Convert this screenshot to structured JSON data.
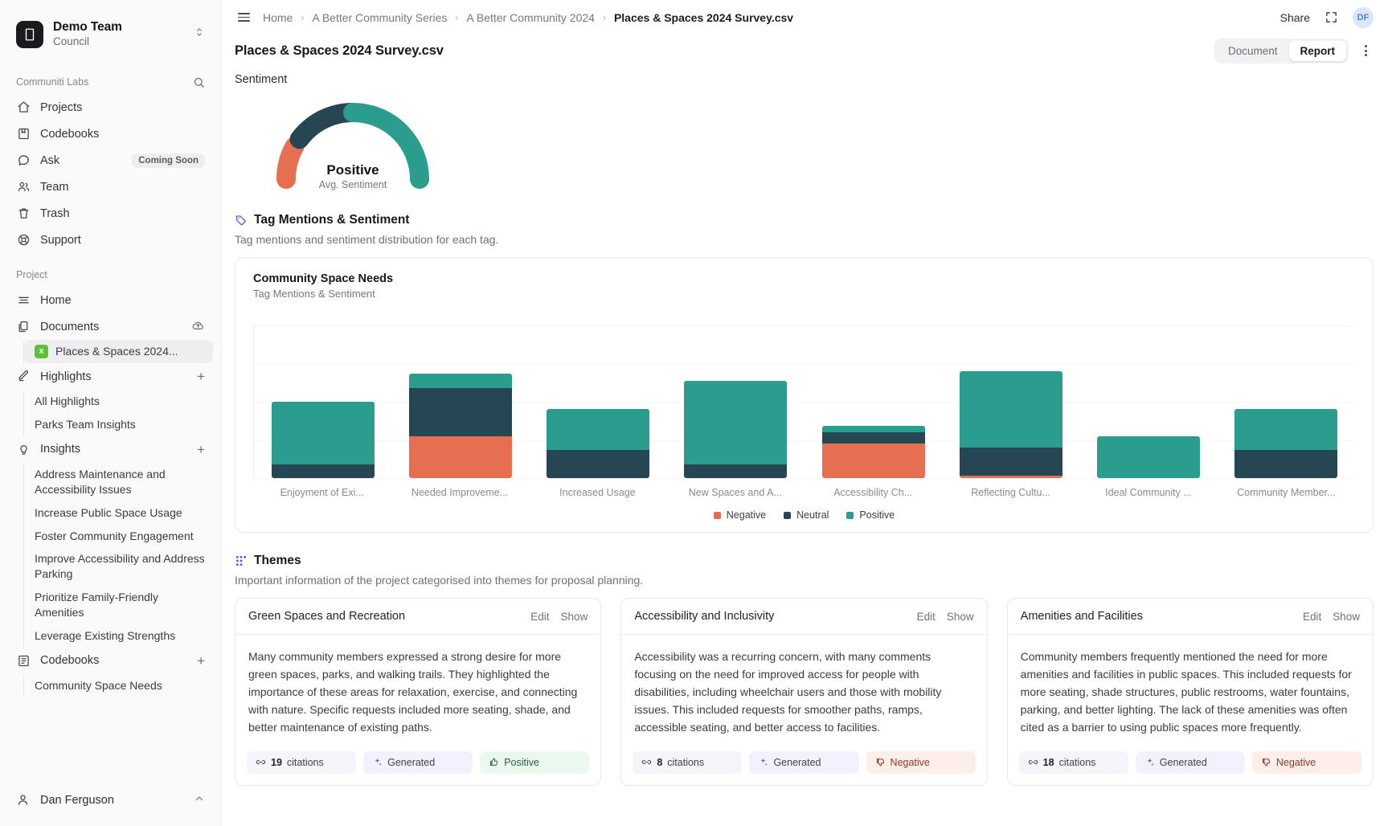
{
  "sidebar": {
    "team": {
      "name": "Demo Team",
      "subtitle": "Council",
      "logo_icon": "building-icon",
      "switcher_icon": "chevron-up-down-icon"
    },
    "labs_section": {
      "title": "Communiti Labs",
      "search_icon": "search-icon"
    },
    "labs_items": [
      {
        "label": "Projects",
        "icon": "home-icon",
        "badge": ""
      },
      {
        "label": "Codebooks",
        "icon": "book-icon",
        "badge": ""
      },
      {
        "label": "Ask",
        "icon": "chat-bubble-icon",
        "badge": "Coming Soon"
      },
      {
        "label": "Team",
        "icon": "users-icon",
        "badge": ""
      },
      {
        "label": "Trash",
        "icon": "trash-icon",
        "badge": ""
      },
      {
        "label": "Support",
        "icon": "lifebuoy-icon",
        "badge": ""
      }
    ],
    "project_section": {
      "title": "Project"
    },
    "project_items": [
      {
        "label": "Home",
        "icon": "list-icon",
        "action": ""
      },
      {
        "label": "Documents",
        "icon": "documents-icon",
        "action": "upload-cloud-icon"
      }
    ],
    "document_child": {
      "label": "Places & Spaces 2024...",
      "badge": "x"
    },
    "highlights": {
      "label": "Highlights",
      "icon": "highlighter-icon",
      "action": "plus-icon",
      "children": [
        "All Highlights",
        "Parks Team Insights"
      ]
    },
    "insights": {
      "label": "Insights",
      "icon": "lightbulb-icon",
      "action": "plus-icon",
      "children": [
        "Address Maintenance and Accessibility Issues",
        "Increase Public Space Usage",
        "Foster Community Engagement",
        "Improve Accessibility and Address Parking",
        "Prioritize Family-Friendly Amenities",
        "Leverage Existing Strengths"
      ]
    },
    "codebooks": {
      "label": "Codebooks",
      "icon": "codebook-icon",
      "action": "plus-icon",
      "children": [
        "Community Space Needs"
      ]
    },
    "user": {
      "name": "Dan Ferguson",
      "icon": "person-icon",
      "collapse_icon": "chevron-up-icon"
    }
  },
  "topbar": {
    "menu_icon": "hamburger-icon",
    "breadcrumbs": [
      "Home",
      "A Better Community Series",
      "A Better Community 2024",
      "Places & Spaces 2024 Survey.csv"
    ],
    "separator": "›",
    "share_label": "Share",
    "expand_icon": "expand-icon",
    "avatar_initials": "DF"
  },
  "titlebar": {
    "document_title": "Places & Spaces 2024 Survey.csv",
    "view_options": [
      "Document",
      "Report"
    ],
    "active_view": "Report",
    "more_icon": "kebab-menu-icon"
  },
  "sentiment": {
    "label": "Sentiment",
    "value": "Positive",
    "caption": "Avg. Sentiment"
  },
  "tag_section": {
    "icon": "tag-icon",
    "title": "Tag Mentions & Sentiment",
    "description": "Tag mentions and sentiment distribution for each tag."
  },
  "themes_section": {
    "icon": "themes-icon",
    "title": "Themes",
    "description": "Important information of the project categorised into themes for proposal planning."
  },
  "themes": [
    {
      "title": "Green Spaces and Recreation",
      "edit_label": "Edit",
      "show_label": "Show",
      "body": "Many community members expressed a strong desire for more green spaces, parks, and walking trails. They highlighted the importance of these areas for relaxation, exercise, and connecting with nature. Specific requests included more seating, shade, and better maintenance of existing paths.",
      "citations_count": "19",
      "citations_label": "citations",
      "generated_label": "Generated",
      "sentiment_label": "Positive",
      "sentiment_type": "positive",
      "citation_icon": "link-icon",
      "generated_icon": "sparkles-icon",
      "sentiment_icon": "thumbs-up-icon"
    },
    {
      "title": "Accessibility and Inclusivity",
      "edit_label": "Edit",
      "show_label": "Show",
      "body": "Accessibility was a recurring concern, with many comments focusing on the need for improved access for people with disabilities, including wheelchair users and those with mobility issues. This included requests for smoother paths, ramps, accessible seating, and better access to facilities.",
      "citations_count": "8",
      "citations_label": "citations",
      "generated_label": "Generated",
      "sentiment_label": "Negative",
      "sentiment_type": "negative",
      "citation_icon": "link-icon",
      "generated_icon": "sparkles-icon",
      "sentiment_icon": "thumbs-down-icon"
    },
    {
      "title": "Amenities and Facilities",
      "edit_label": "Edit",
      "show_label": "Show",
      "body": "Community members frequently mentioned the need for more amenities and facilities in public spaces. This included requests for more seating, shade structures, public restrooms, water fountains, parking, and better lighting. The lack of these amenities was often cited as a barrier to using public spaces more frequently.",
      "citations_count": "18",
      "citations_label": "citations",
      "generated_label": "Generated",
      "sentiment_label": "Negative",
      "sentiment_type": "negative",
      "citation_icon": "link-icon",
      "generated_icon": "sparkles-icon",
      "sentiment_icon": "thumbs-down-icon"
    }
  ],
  "colors": {
    "negative": "#e76f51",
    "neutral": "#264653",
    "positive": "#2a9d8f",
    "accent": "#5a5ae0"
  },
  "chart_data": {
    "type": "bar",
    "title": "Community Space Needs",
    "subtitle": "Tag Mentions & Sentiment",
    "stacked": true,
    "xlabel": "",
    "ylabel": "",
    "ylim": [
      0,
      22
    ],
    "grid": true,
    "legend_position": "bottom",
    "legend": [
      "Negative",
      "Neutral",
      "Positive"
    ],
    "categories": [
      "Enjoyment of Exi...",
      "Needed Improveme...",
      "Increased Usage",
      "New Spaces and A...",
      "Accessibility Ch...",
      "Reflecting Cultu...",
      "Ideal Community ...",
      "Community Member..."
    ],
    "series": [
      {
        "name": "Negative",
        "color": "#e76f51",
        "values": [
          0,
          6,
          0,
          0,
          5,
          0.4,
          0,
          0
        ]
      },
      {
        "name": "Neutral",
        "color": "#264653",
        "values": [
          2,
          7,
          4,
          2,
          1.6,
          4,
          0,
          4
        ]
      },
      {
        "name": "Positive",
        "color": "#2a9d8f",
        "values": [
          9,
          2,
          6,
          12,
          0.9,
          11,
          6,
          6
        ]
      }
    ]
  }
}
